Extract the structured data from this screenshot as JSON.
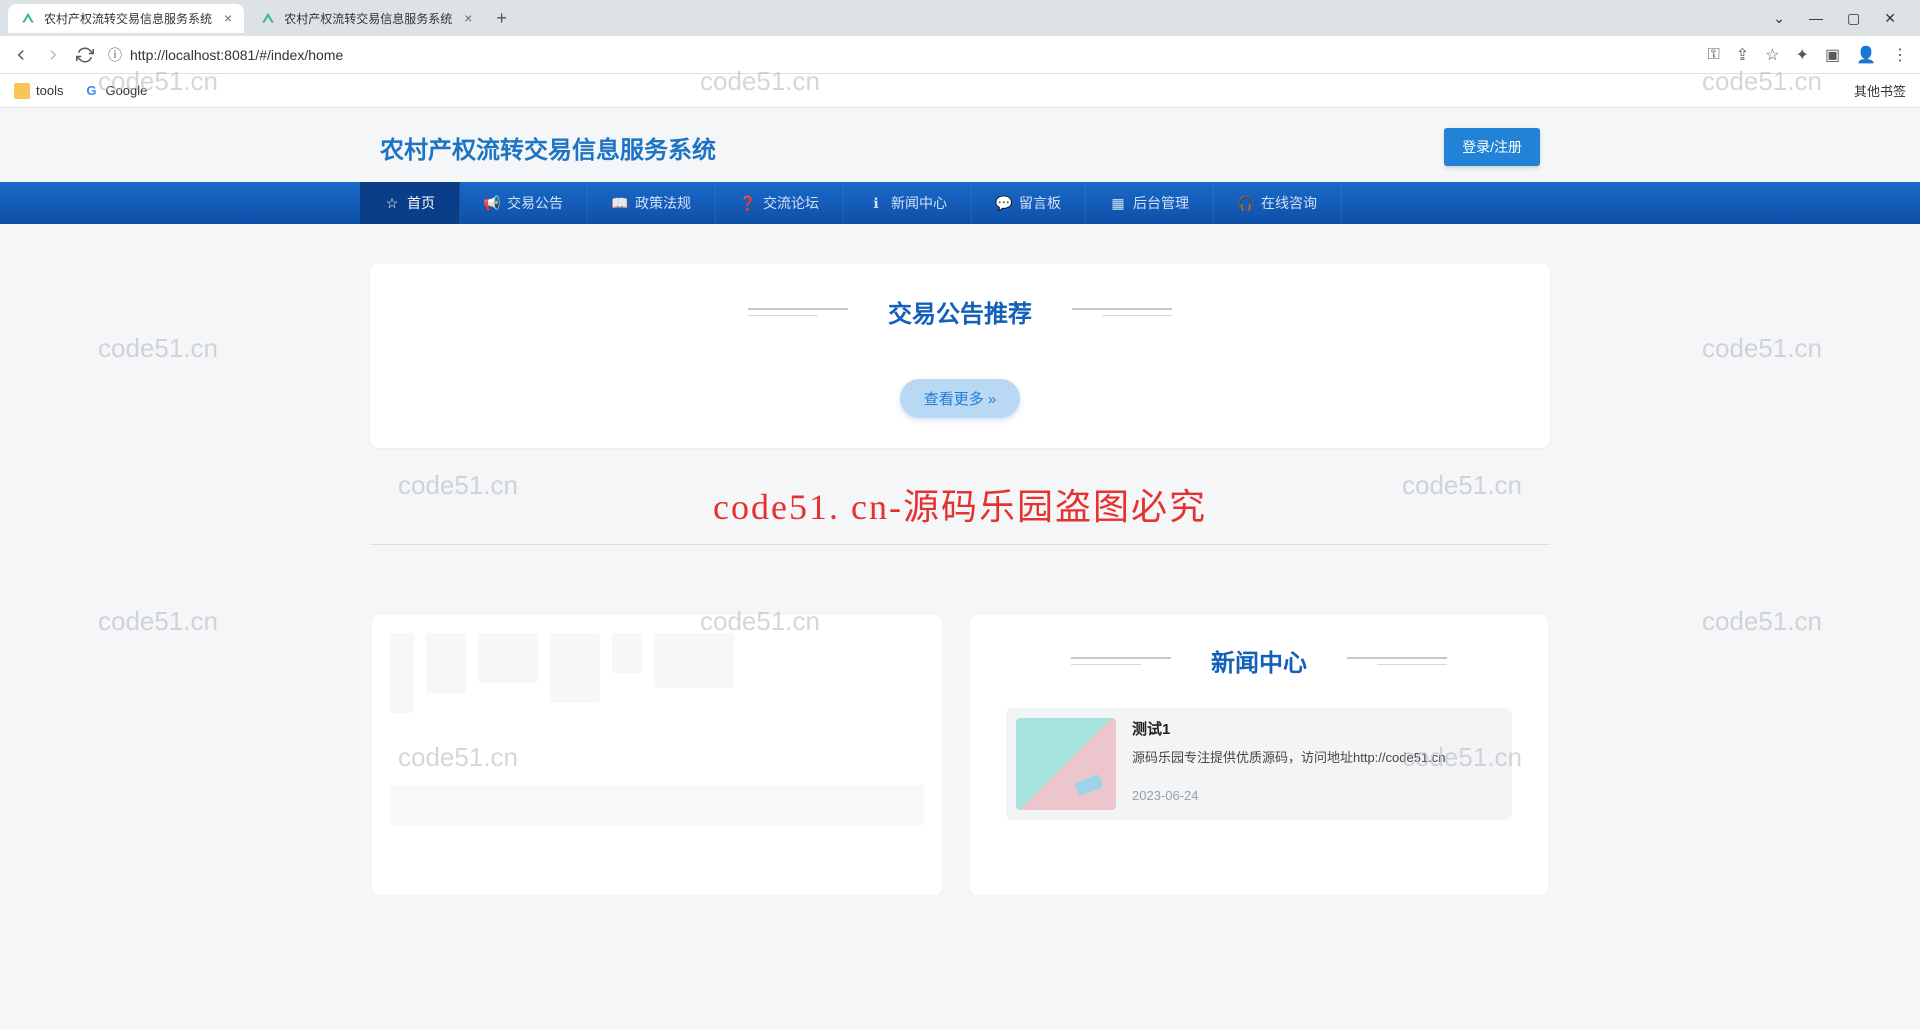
{
  "browser": {
    "tabs": [
      {
        "title": "农村产权流转交易信息服务系统",
        "active": true
      },
      {
        "title": "农村产权流转交易信息服务系统",
        "active": false
      }
    ],
    "url": "http://localhost:8081/#/index/home",
    "bookmarks": [
      {
        "label": "tools",
        "icon": "folder"
      },
      {
        "label": "Google",
        "icon": "google"
      }
    ],
    "other_bookmarks_label": "其他书签"
  },
  "header": {
    "site_title": "农村产权流转交易信息服务系统",
    "login_label": "登录/注册"
  },
  "nav": {
    "items": [
      {
        "icon": "star",
        "label": "首页",
        "active": true
      },
      {
        "icon": "megaphone",
        "label": "交易公告"
      },
      {
        "icon": "book",
        "label": "政策法规"
      },
      {
        "icon": "question",
        "label": "交流论坛"
      },
      {
        "icon": "info",
        "label": "新闻中心"
      },
      {
        "icon": "message",
        "label": "留言板"
      },
      {
        "icon": "grid",
        "label": "后台管理"
      },
      {
        "icon": "headset",
        "label": "在线咨询"
      }
    ]
  },
  "sections": {
    "announce_title": "交易公告推荐",
    "more_label": "查看更多",
    "news_title": "新闻中心"
  },
  "news": [
    {
      "title": "测试1",
      "desc": "源码乐园专注提供优质源码，访问地址http://code51.cn",
      "date": "2023-06-24"
    }
  ],
  "watermarks": {
    "small": "code51.cn",
    "big": "code51. cn-源码乐园盗图必究"
  }
}
